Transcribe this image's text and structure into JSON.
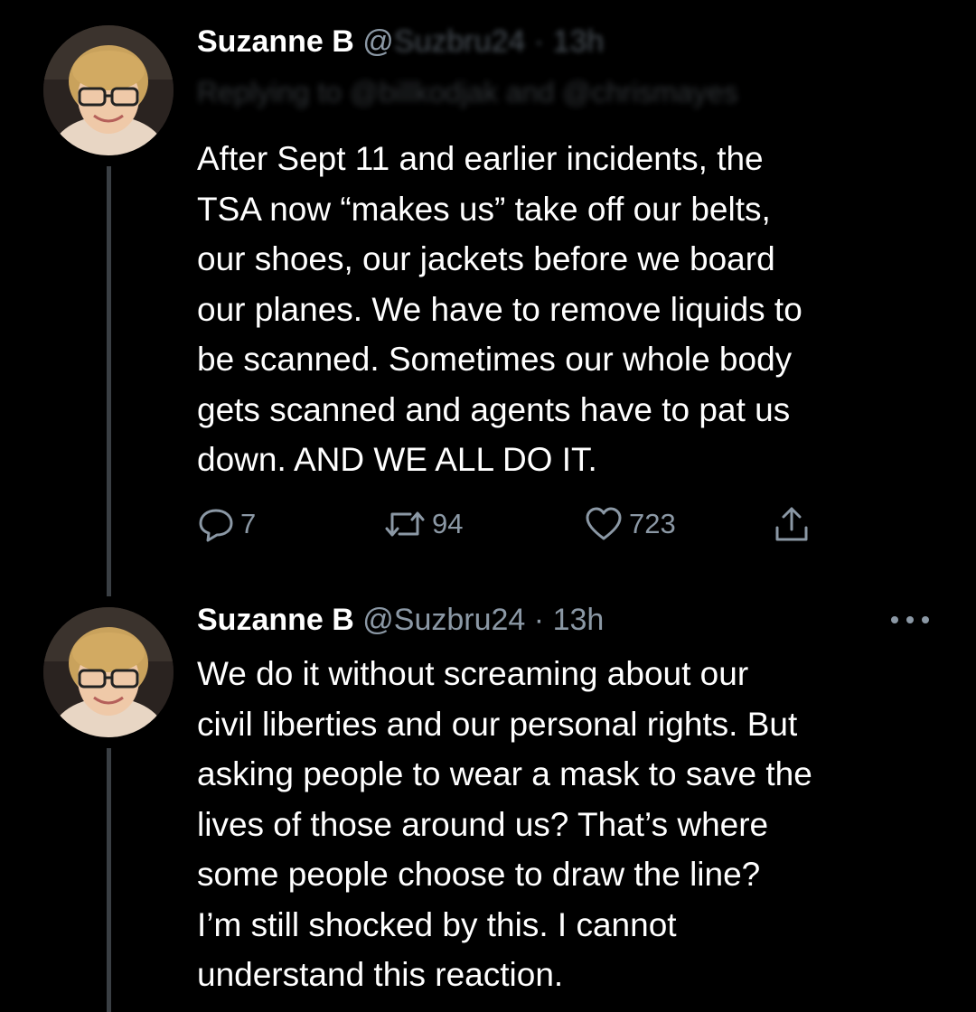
{
  "tweets": [
    {
      "author": {
        "display_name": "Suzanne B",
        "handle_partial": "@",
        "obscured_meta": "Suzbru24 · 13h",
        "avatar": "profile-photo"
      },
      "reply_context": "Replying to @billkodjak and @chrismayes",
      "text": "After Sept 11 and earlier incidents, the\nTSA now “makes us” take off our belts,\nour shoes, our jackets before we board\nour planes. We have to remove liquids to\nbe scanned. Sometimes our whole body\ngets scanned and agents have to pat us\ndown.  AND WE ALL DO IT.",
      "actions": {
        "reply_icon": "speech-bubble-icon",
        "reply_count": "7",
        "retweet_icon": "retweet-icon",
        "retweet_count": "94",
        "like_icon": "heart-icon",
        "like_count": "723",
        "share_icon": "share-icon"
      }
    },
    {
      "author": {
        "display_name": "Suzanne B",
        "handle": "@Suzbru24",
        "separator": "·",
        "timestamp": "13h",
        "avatar": "profile-photo"
      },
      "more_icon": "more-dots-icon",
      "text": "We do it without screaming about our\ncivil liberties and our personal rights. But\nasking people to wear a mask to save the\nlives of those around us?  That’s where\nsome people choose to draw the line?\nI’m still shocked by this. I cannot\nunderstand this reaction."
    }
  ],
  "colors": {
    "background": "#000000",
    "primary_text": "#ffffff",
    "secondary_text": "#8b98a5",
    "thread_line": "#3a3f44"
  }
}
